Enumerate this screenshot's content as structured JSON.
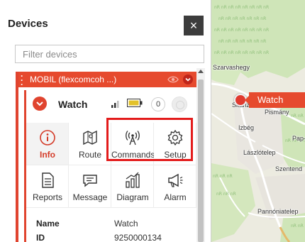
{
  "panel": {
    "title": "Devices",
    "close_icon": "×",
    "filter_placeholder": "Filter devices"
  },
  "device_group": {
    "name": "MOBIL (flexcomcoh ...)",
    "color": "#e64a2e"
  },
  "device": {
    "name": "Watch",
    "message_count": "0",
    "signal_icon": "signal-bars-icon",
    "battery_icon": "battery-icon"
  },
  "actions": [
    {
      "label": "Info",
      "icon": "info-icon"
    },
    {
      "label": "Route",
      "icon": "map-route-icon"
    },
    {
      "label": "Commands",
      "icon": "antenna-icon"
    },
    {
      "label": "Setup",
      "icon": "gear-icon"
    },
    {
      "label": "Reports",
      "icon": "report-icon"
    },
    {
      "label": "Message",
      "icon": "chat-icon"
    },
    {
      "label": "Diagram",
      "icon": "chart-icon"
    },
    {
      "label": "Alarm",
      "icon": "megaphone-icon"
    }
  ],
  "properties": [
    {
      "key": "Name",
      "value": "Watch"
    },
    {
      "key": "ID",
      "value": "9250000134"
    }
  ],
  "map": {
    "marker_label": "Watch",
    "places": [
      "Szarvashegy",
      "Skanzen",
      "Pismány",
      "Izbég",
      "Pap-s",
      "Lászlótelep",
      "Szentend",
      "Pannóniatelep"
    ],
    "accent": "#e64a2e"
  }
}
